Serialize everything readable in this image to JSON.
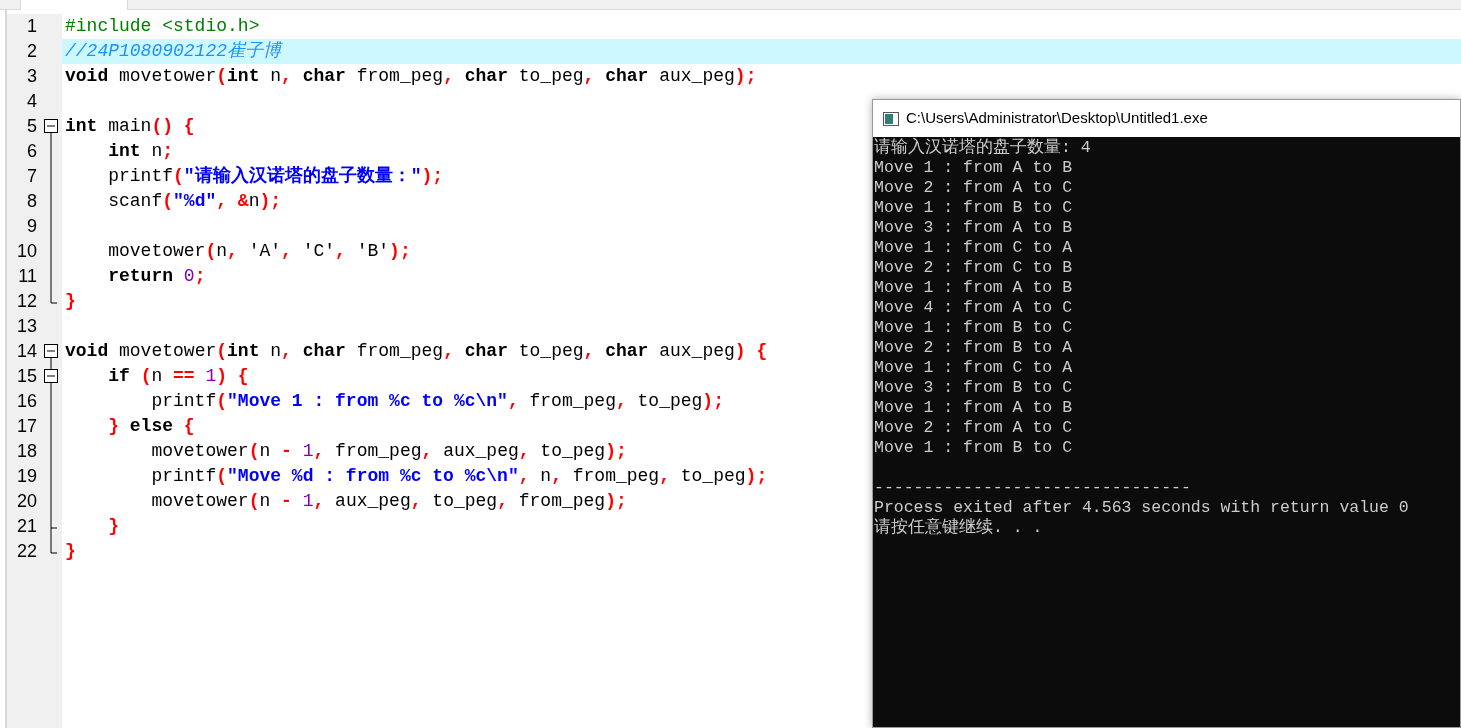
{
  "editor": {
    "lines": [
      {
        "number": "1",
        "highlighted": false,
        "kind": "plain",
        "tokens": [
          {
            "kind": "preprocessor",
            "text": "#include <stdio.h>"
          }
        ]
      },
      {
        "number": "2",
        "highlighted": true,
        "kind": "plain",
        "tokens": [
          {
            "kind": "comment",
            "text": "//24P1080902122崔子博"
          }
        ]
      },
      {
        "number": "3",
        "highlighted": false,
        "kind": "plain",
        "tokens": [
          {
            "kind": "keyword",
            "text": "void"
          },
          {
            "kind": "plain",
            "text": " movetower"
          },
          {
            "kind": "symbol",
            "text": "("
          },
          {
            "kind": "keyword",
            "text": "int"
          },
          {
            "kind": "plain",
            "text": " n"
          },
          {
            "kind": "symbol",
            "text": ", "
          },
          {
            "kind": "keyword",
            "text": "char"
          },
          {
            "kind": "plain",
            "text": " from_peg"
          },
          {
            "kind": "symbol",
            "text": ", "
          },
          {
            "kind": "keyword",
            "text": "char"
          },
          {
            "kind": "plain",
            "text": " to_peg"
          },
          {
            "kind": "symbol",
            "text": ", "
          },
          {
            "kind": "keyword",
            "text": "char"
          },
          {
            "kind": "plain",
            "text": " aux_peg"
          },
          {
            "kind": "symbol",
            "text": ");"
          }
        ]
      },
      {
        "number": "4",
        "highlighted": false,
        "kind": "plain"
      },
      {
        "number": "5",
        "highlighted": false,
        "kind": "fold_start",
        "tokens": [
          {
            "kind": "keyword",
            "text": "int"
          },
          {
            "kind": "plain",
            "text": " main"
          },
          {
            "kind": "symbol",
            "text": "() {"
          }
        ]
      },
      {
        "number": "6",
        "highlighted": false,
        "kind": "fold_line",
        "tokens": [
          {
            "kind": "keyword",
            "text": "    int"
          },
          {
            "kind": "plain",
            "text": " n"
          },
          {
            "kind": "symbol",
            "text": ";"
          }
        ]
      },
      {
        "number": "7",
        "highlighted": false,
        "kind": "fold_line",
        "tokens": [
          {
            "kind": "plain",
            "text": "    printf"
          },
          {
            "kind": "symbol",
            "text": "("
          },
          {
            "kind": "string",
            "text": "\"请输入汉诺塔的盘子数量：\""
          },
          {
            "kind": "symbol",
            "text": ");"
          }
        ]
      },
      {
        "number": "8",
        "highlighted": false,
        "kind": "fold_line",
        "tokens": [
          {
            "kind": "plain",
            "text": "    scanf"
          },
          {
            "kind": "symbol",
            "text": "("
          },
          {
            "kind": "string",
            "text": "\"%d\""
          },
          {
            "kind": "symbol",
            "text": ", &"
          },
          {
            "kind": "plain",
            "text": "n"
          },
          {
            "kind": "symbol",
            "text": ");"
          }
        ]
      },
      {
        "number": "9",
        "highlighted": false,
        "kind": "fold_line"
      },
      {
        "number": "10",
        "highlighted": false,
        "kind": "fold_line",
        "tokens": [
          {
            "kind": "plain",
            "text": "    movetower"
          },
          {
            "kind": "symbol",
            "text": "("
          },
          {
            "kind": "plain",
            "text": "n"
          },
          {
            "kind": "symbol",
            "text": ", "
          },
          {
            "kind": "plain",
            "text": "'A'"
          },
          {
            "kind": "symbol",
            "text": ", "
          },
          {
            "kind": "plain",
            "text": "'C'"
          },
          {
            "kind": "symbol",
            "text": ", "
          },
          {
            "kind": "plain",
            "text": "'B'"
          },
          {
            "kind": "symbol",
            "text": ");"
          }
        ]
      },
      {
        "number": "11",
        "highlighted": false,
        "kind": "fold_line",
        "tokens": [
          {
            "kind": "keyword",
            "text": "    return "
          },
          {
            "kind": "number",
            "text": "0"
          },
          {
            "kind": "symbol",
            "text": ";"
          }
        ]
      },
      {
        "number": "12",
        "highlighted": false,
        "kind": "fold_end",
        "tokens": [
          {
            "kind": "symbol",
            "text": "}"
          }
        ]
      },
      {
        "number": "13",
        "highlighted": false,
        "kind": "plain"
      },
      {
        "number": "14",
        "highlighted": false,
        "kind": "fold_start",
        "tokens": [
          {
            "kind": "keyword",
            "text": "void"
          },
          {
            "kind": "plain",
            "text": " movetower"
          },
          {
            "kind": "symbol",
            "text": "("
          },
          {
            "kind": "keyword",
            "text": "int"
          },
          {
            "kind": "plain",
            "text": " n"
          },
          {
            "kind": "symbol",
            "text": ", "
          },
          {
            "kind": "keyword",
            "text": "char"
          },
          {
            "kind": "plain",
            "text": " from_peg"
          },
          {
            "kind": "symbol",
            "text": ", "
          },
          {
            "kind": "keyword",
            "text": "char"
          },
          {
            "kind": "plain",
            "text": " to_peg"
          },
          {
            "kind": "symbol",
            "text": ", "
          },
          {
            "kind": "keyword",
            "text": "char"
          },
          {
            "kind": "plain",
            "text": " aux_peg"
          },
          {
            "kind": "symbol",
            "text": ") {"
          }
        ]
      },
      {
        "number": "15",
        "highlighted": false,
        "kind": "fold_nested_start",
        "tokens": [
          {
            "kind": "keyword",
            "text": "    if "
          },
          {
            "kind": "symbol",
            "text": "("
          },
          {
            "kind": "plain",
            "text": "n "
          },
          {
            "kind": "symbol",
            "text": "== "
          },
          {
            "kind": "number",
            "text": "1"
          },
          {
            "kind": "symbol",
            "text": ") {"
          }
        ]
      },
      {
        "number": "16",
        "highlighted": false,
        "kind": "fold_line",
        "tokens": [
          {
            "kind": "plain",
            "text": "        printf"
          },
          {
            "kind": "symbol",
            "text": "("
          },
          {
            "kind": "string",
            "text": "\"Move 1 : from %c to %c\\n\""
          },
          {
            "kind": "symbol",
            "text": ", "
          },
          {
            "kind": "plain",
            "text": "from_peg"
          },
          {
            "kind": "symbol",
            "text": ", "
          },
          {
            "kind": "plain",
            "text": "to_peg"
          },
          {
            "kind": "symbol",
            "text": ");"
          }
        ]
      },
      {
        "number": "17",
        "highlighted": false,
        "kind": "fold_line",
        "tokens": [
          {
            "kind": "symbol",
            "text": "    } "
          },
          {
            "kind": "keyword",
            "text": "else "
          },
          {
            "kind": "symbol",
            "text": "{"
          }
        ]
      },
      {
        "number": "18",
        "highlighted": false,
        "kind": "fold_line",
        "tokens": [
          {
            "kind": "plain",
            "text": "        movetower"
          },
          {
            "kind": "symbol",
            "text": "("
          },
          {
            "kind": "plain",
            "text": "n "
          },
          {
            "kind": "symbol",
            "text": "- "
          },
          {
            "kind": "number",
            "text": "1"
          },
          {
            "kind": "symbol",
            "text": ", "
          },
          {
            "kind": "plain",
            "text": "from_peg"
          },
          {
            "kind": "symbol",
            "text": ", "
          },
          {
            "kind": "plain",
            "text": "aux_peg"
          },
          {
            "kind": "symbol",
            "text": ", "
          },
          {
            "kind": "plain",
            "text": "to_peg"
          },
          {
            "kind": "symbol",
            "text": ");"
          }
        ]
      },
      {
        "number": "19",
        "highlighted": false,
        "kind": "fold_line",
        "tokens": [
          {
            "kind": "plain",
            "text": "        printf"
          },
          {
            "kind": "symbol",
            "text": "("
          },
          {
            "kind": "string",
            "text": "\"Move %d : from %c to %c\\n\""
          },
          {
            "kind": "symbol",
            "text": ", "
          },
          {
            "kind": "plain",
            "text": "n"
          },
          {
            "kind": "symbol",
            "text": ", "
          },
          {
            "kind": "plain",
            "text": "from_peg"
          },
          {
            "kind": "symbol",
            "text": ", "
          },
          {
            "kind": "plain",
            "text": "to_peg"
          },
          {
            "kind": "symbol",
            "text": ");"
          }
        ]
      },
      {
        "number": "20",
        "highlighted": false,
        "kind": "fold_line",
        "tokens": [
          {
            "kind": "plain",
            "text": "        movetower"
          },
          {
            "kind": "symbol",
            "text": "("
          },
          {
            "kind": "plain",
            "text": "n "
          },
          {
            "kind": "symbol",
            "text": "- "
          },
          {
            "kind": "number",
            "text": "1"
          },
          {
            "kind": "symbol",
            "text": ", "
          },
          {
            "kind": "plain",
            "text": "aux_peg"
          },
          {
            "kind": "symbol",
            "text": ", "
          },
          {
            "kind": "plain",
            "text": "to_peg"
          },
          {
            "kind": "symbol",
            "text": ", "
          },
          {
            "kind": "plain",
            "text": "from_peg"
          },
          {
            "kind": "symbol",
            "text": ");"
          }
        ]
      },
      {
        "number": "21",
        "highlighted": false,
        "kind": "fold_branch_end",
        "tokens": [
          {
            "kind": "symbol",
            "text": "    }"
          }
        ]
      },
      {
        "number": "22",
        "highlighted": false,
        "kind": "fold_end",
        "tokens": [
          {
            "kind": "symbol",
            "text": "}"
          }
        ]
      }
    ]
  },
  "console": {
    "title": "C:\\Users\\Administrator\\Desktop\\Untitled1.exe",
    "output": [
      "请输入汉诺塔的盘子数量: 4",
      "Move 1 : from A to B",
      "Move 2 : from A to C",
      "Move 1 : from B to C",
      "Move 3 : from A to B",
      "Move 1 : from C to A",
      "Move 2 : from C to B",
      "Move 1 : from A to B",
      "Move 4 : from A to C",
      "Move 1 : from B to C",
      "Move 2 : from B to A",
      "Move 1 : from C to A",
      "Move 3 : from B to C",
      "Move 1 : from A to B",
      "Move 2 : from A to C",
      "Move 1 : from B to C"
    ],
    "separator": "--------------------------------",
    "footer": [
      "Process exited after 4.563 seconds with return value 0",
      "请按任意键继续. . ."
    ]
  }
}
